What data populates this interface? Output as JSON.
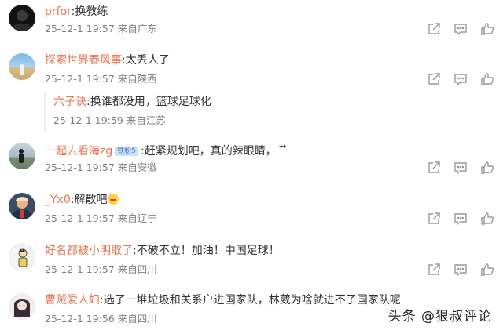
{
  "comments": [
    {
      "user": "prfor",
      "text": ":换教练",
      "time": "25-12-1 19:57",
      "location": "来自广东"
    },
    {
      "user": "探索世界春风事",
      "text": ":太丢人了",
      "time": "25-12-1 19:57",
      "location": "来自陕西",
      "reply": {
        "user": "六子诀",
        "text": ":换谁都没用，篮球足球化",
        "time": "25-12-1 19:59",
        "location": "来自江苏"
      }
    },
    {
      "user": "一起去看海zg",
      "badge": "铁粉5",
      "text": ":赶紧规划吧，真的辣眼睛，",
      "symbol": "艹",
      "time": "25-12-1 19:57",
      "location": "来自安徽"
    },
    {
      "user": "_Yx0",
      "text": ":解散吧",
      "emoji": "laugh-emoji",
      "time": "25-12-1 19:57",
      "location": "来自辽宁"
    },
    {
      "user": "好名都被小明取了",
      "text": ":不破不立！加油！中国足球！",
      "time": "25-12-1 19:57",
      "location": "来自四川"
    },
    {
      "user": "曹贼爱人妇",
      "text": ":选了一堆垃圾和关系户进国家队，林葳为啥就进不了国家队呢",
      "time": "25-12-1 19:56",
      "location": "来自四川"
    }
  ],
  "watermark": "头条 @狠叔评论",
  "icons": [
    "share-icon",
    "comment-icon",
    "like-icon"
  ],
  "colors": {
    "username": "#eb7350",
    "meta": "#808080",
    "text": "#333333",
    "icon": "#999999"
  }
}
